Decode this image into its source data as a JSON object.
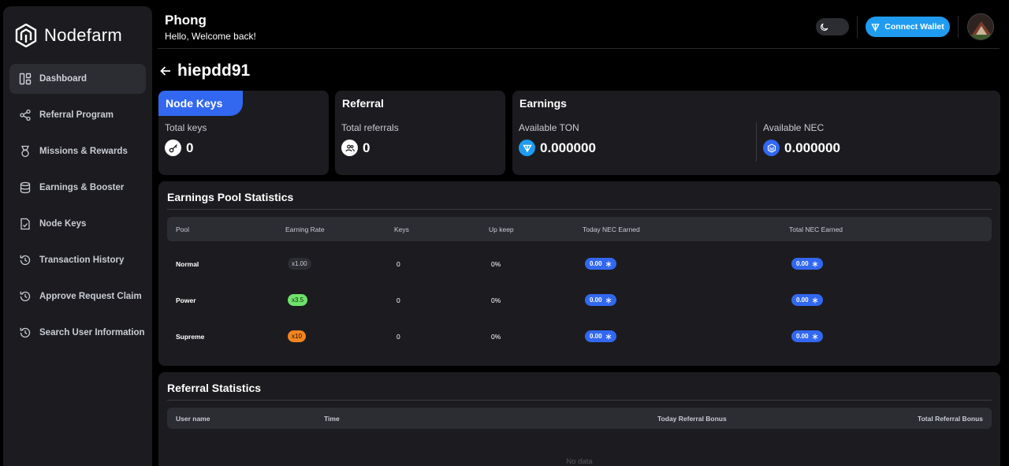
{
  "brand": {
    "name": "Nodefarm"
  },
  "sidebar": {
    "items": [
      {
        "label": "Dashboard",
        "icon": "dashboard-icon",
        "active": true
      },
      {
        "label": "Referral Program",
        "icon": "share-icon"
      },
      {
        "label": "Missions & Rewards",
        "icon": "medal-icon"
      },
      {
        "label": "Earnings & Booster",
        "icon": "database-icon"
      },
      {
        "label": "Node Keys",
        "icon": "document-check-icon"
      },
      {
        "label": "Transaction History",
        "icon": "history-icon"
      },
      {
        "label": "Approve Request Claim",
        "icon": "history-icon"
      },
      {
        "label": "Search User Information",
        "icon": "history-icon"
      }
    ]
  },
  "header": {
    "name": "Phong",
    "greeting": "Hello, Welcome back!",
    "connect_wallet": "Connect Wallet"
  },
  "page": {
    "title": "hiepdd91"
  },
  "cards": {
    "node_keys": {
      "title": "Node Keys",
      "label": "Total keys",
      "value": "0"
    },
    "referral": {
      "title": "Referral",
      "label": "Total referrals",
      "value": "0"
    },
    "earnings": {
      "title": "Earnings",
      "ton_label": "Available TON",
      "ton_value": "0.000000",
      "nec_label": "Available NEC",
      "nec_value": "0.000000"
    }
  },
  "pool_stats": {
    "title": "Earnings Pool Statistics",
    "columns": [
      "Pool",
      "Earning Rate",
      "Keys",
      "Up keep",
      "Today NEC Earned",
      "Total NEC Earned"
    ],
    "rows": [
      {
        "pool": "Normal",
        "rate": "x1.00",
        "keys": "0",
        "upkeep": "0%",
        "today": "0.00",
        "total": "0.00",
        "rate_color": "#2c2d33",
        "rate_text": "#c9ccd3"
      },
      {
        "pool": "Power",
        "rate": "x3.5",
        "keys": "0",
        "upkeep": "0%",
        "today": "0.00",
        "total": "0.00",
        "rate_color": "#6ee26a",
        "rate_text": "#0b2b0a"
      },
      {
        "pool": "Supreme",
        "rate": "x10",
        "keys": "0",
        "upkeep": "0%",
        "today": "0.00",
        "total": "0.00",
        "rate_color": "#f0841f",
        "rate_text": "#2a1200"
      }
    ]
  },
  "referral_stats": {
    "title": "Referral Statistics",
    "columns": [
      "User name",
      "Time",
      "Today Referral Bonus",
      "Total Referral Bonus"
    ],
    "empty_text": "No data"
  },
  "colors": {
    "accent": "#3268f0",
    "ton": "#1f9cf0",
    "card_bg": "#1c1c20"
  }
}
